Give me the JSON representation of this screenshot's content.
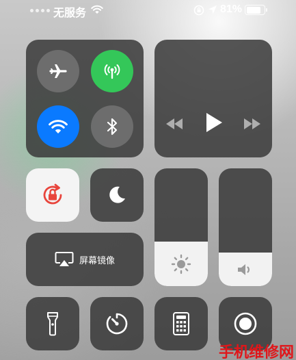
{
  "status_bar": {
    "carrier": "无服务",
    "battery_percent": "81%",
    "battery_level": 0.81,
    "icons": [
      "wifi-icon",
      "orientation-lock-icon",
      "location-arrow-icon",
      "battery-icon"
    ]
  },
  "connectivity": {
    "airplane": {
      "icon": "airplane-icon",
      "on": false
    },
    "cellular": {
      "icon": "antenna-icon",
      "on": true
    },
    "wifi": {
      "icon": "wifi-icon",
      "on": true
    },
    "bluetooth": {
      "icon": "bluetooth-icon",
      "on": false
    }
  },
  "media": {
    "icons": [
      "rewind-icon",
      "play-icon",
      "fast-forward-icon"
    ]
  },
  "orientation_lock": {
    "icon": "orientation-lock-icon",
    "on": true,
    "color": "#e8453c"
  },
  "do_not_disturb": {
    "icon": "moon-icon",
    "on": false
  },
  "brightness": {
    "icon": "sun-icon",
    "level": 0.38
  },
  "volume": {
    "icon": "speaker-icon",
    "level": 0.28
  },
  "screen_mirroring": {
    "label": "屏幕镜像",
    "icon": "airplay-icon"
  },
  "shortcuts": [
    {
      "name": "flashlight",
      "icon": "flashlight-icon"
    },
    {
      "name": "timer",
      "icon": "timer-icon"
    },
    {
      "name": "calculator",
      "icon": "calculator-icon"
    },
    {
      "name": "screen-recording",
      "icon": "record-icon"
    }
  ],
  "watermark": "手机维修网",
  "colors": {
    "green": "#34c759",
    "blue": "#0a7aff",
    "red": "#e8453c",
    "watermark": "#e0161a"
  }
}
